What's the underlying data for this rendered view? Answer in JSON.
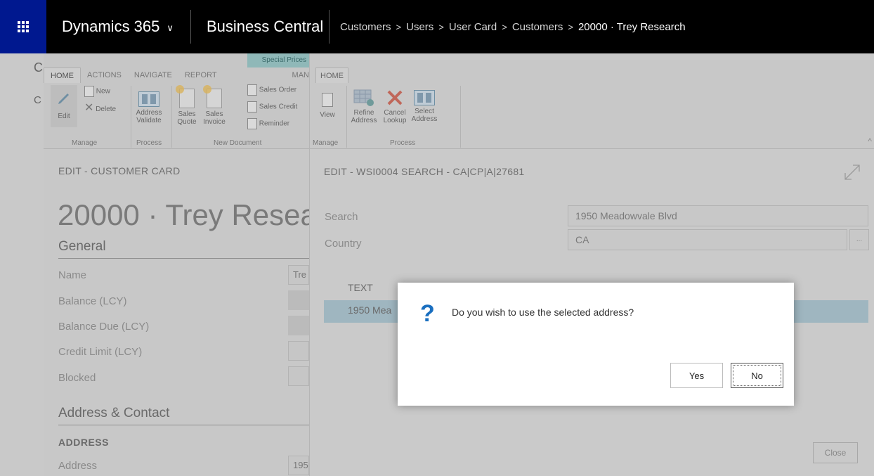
{
  "topbar": {
    "brand": "Dynamics 365",
    "brand_chevron": "∨",
    "product": "Business Central",
    "breadcrumb": [
      "Customers",
      "Users",
      "User Card",
      "Customers"
    ],
    "breadcrumb_current": "20000 · Trey Research",
    "breadcrumb_sep": ">"
  },
  "left_ribbon": {
    "tabs": [
      "HOME",
      "ACTIONS",
      "NAVIGATE",
      "REPORT"
    ],
    "special_tab": "Special Prices",
    "special_tab_sub": "MAN",
    "buttons": {
      "edit": "Edit",
      "new": "New",
      "delete": "Delete",
      "address_validate_1": "Address",
      "address_validate_2": "Validate",
      "sales_quote_1": "Sales",
      "sales_quote_2": "Quote",
      "sales_invoice_1": "Sales",
      "sales_invoice_2": "Invoice",
      "sales_order": "Sales Order",
      "sales_credit": "Sales Credit",
      "reminder": "Reminder"
    },
    "groups": {
      "manage": "Manage",
      "process": "Process",
      "new_document": "New Document"
    }
  },
  "left_card": {
    "strip_letters": [
      "C",
      "C"
    ],
    "title": "EDIT - CUSTOMER CARD",
    "heading": "20000 · Trey Resea",
    "section_general": "General",
    "fields": [
      {
        "label": "Name",
        "value": "Tre"
      },
      {
        "label": "Balance (LCY)",
        "value": ""
      },
      {
        "label": "Balance Due (LCY)",
        "value": ""
      },
      {
        "label": "Credit Limit (LCY)",
        "value": ""
      },
      {
        "label": "Blocked",
        "value": ""
      }
    ],
    "section_address": "Address & Contact",
    "sub_address": "ADDRESS",
    "address_label": "Address",
    "address_value": "195"
  },
  "right_pane": {
    "tab": "HOME",
    "buttons": {
      "view": "View",
      "refine_1": "Refine",
      "refine_2": "Address",
      "cancel_1": "Cancel",
      "cancel_2": "Lookup",
      "select_1": "Select",
      "select_2": "Address"
    },
    "groups": {
      "manage": "Manage",
      "process": "Process"
    },
    "collapse": "^",
    "title": "EDIT - WSI0004 SEARCH - CA|CP|A|27681",
    "search_label": "Search",
    "search_value": "1950 Meadowvale Blvd",
    "country_label": "Country",
    "country_value": "CA",
    "lookup_button": "...",
    "column_header": "TEXT",
    "selected_row": "1950 Mea",
    "close_button": "Close"
  },
  "dialog": {
    "icon": "?",
    "message": "Do you wish to use the selected address?",
    "yes": "Yes",
    "no": "No"
  },
  "colors": {
    "waffle": "#00188f",
    "topbar": "#000000",
    "question_mark": "#1a6fc0",
    "selected_row": "#9fb6c0",
    "special_tab": "#8fb8b8"
  }
}
